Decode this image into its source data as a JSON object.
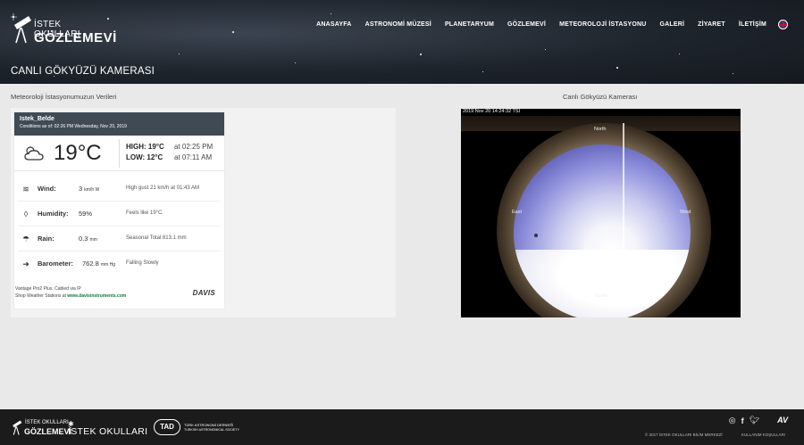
{
  "brand": {
    "line1": "İSTEK OKULLARI",
    "line2": "GÖZLEMEVİ"
  },
  "nav": {
    "items": [
      "ANASAYFA",
      "ASTRONOMİ MÜZESİ",
      "PLANETARYUM",
      "GÖZLEMEVİ",
      "METEOROLOJİ İSTASYONU",
      "GALERİ",
      "ZİYARET",
      "İLETİŞİM"
    ],
    "language_icon": "uk-flag-icon"
  },
  "page": {
    "title": "CANLI GÖKYÜZÜ KAMERASI"
  },
  "weather_section": {
    "heading": "Meteoroloji İstasyonumuzun Verileri"
  },
  "camera_section": {
    "heading": "Canlı Gökyüzü Kamerası"
  },
  "weather": {
    "location": "Istek_Belde",
    "conditions": "Conditions as of: 02:26 PM Wednesday, Nov 20, 2019",
    "temperature": "19°C",
    "high_label": "HIGH: 19°C",
    "high_time": "at 02:25 PM",
    "low_label": "LOW: 12°C",
    "low_time": "at 07:11 AM",
    "rows": [
      {
        "label": "Wind:",
        "value": "3",
        "unit": "km/h W",
        "note": "High gust 21 km/h at 01:43 AM",
        "icon": "wind-icon"
      },
      {
        "label": "Humidity:",
        "value": "59%",
        "unit": "",
        "note": "Feels like 19°C",
        "icon": "droplet-icon"
      },
      {
        "label": "Rain:",
        "value": "0.3",
        "unit": "mm",
        "note": "Seasonal Total 813.1 mm",
        "icon": "rain-icon"
      },
      {
        "label": "Barometer:",
        "value": "762.8",
        "unit": "mm Hg",
        "note": "Falling Slowly",
        "icon": "arrow-icon"
      }
    ],
    "footer_line1": "Vantage Pro2 Plus, Cabled via IP",
    "footer_line2_prefix": "Shop Weather Stations at ",
    "footer_link": "www.davisinstruments.com",
    "davis_logo": "DAVIS"
  },
  "camera": {
    "timestamp": "2019 Nov 20  14:24:32 TSİ",
    "north": "North",
    "south": "South",
    "east": "East",
    "west": "West"
  },
  "footer": {
    "logo1_line1": "İSTEK OKULLARI",
    "logo1_line2": "GÖZLEMEVİ",
    "logo2": "İSTEK OKULLARI",
    "logo3_mark": "TAD",
    "logo3_line1": "TÜRK ASTRONOMİ DERNEĞİ",
    "logo3_line2": "TURKISH ASTRONOMICAL SOCIETY",
    "copyright": "© 2017 İSTEK OKULLARI BİLİM MERKEZİ",
    "terms": "KULLANIM KOŞULLARI",
    "social": [
      "instagram-icon",
      "facebook-icon",
      "twitter-icon"
    ],
    "agency_mark": "AV"
  }
}
